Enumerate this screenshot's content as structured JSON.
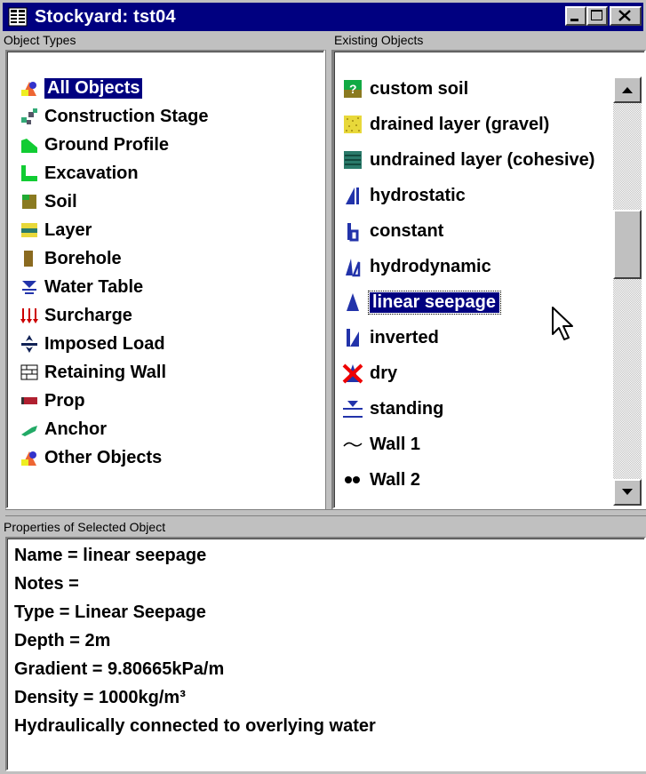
{
  "window": {
    "title": "Stockyard: tst04"
  },
  "object_types": {
    "label": "Object Types",
    "items": [
      {
        "label": "All Objects",
        "icon": "all-objects-icon",
        "selected": true
      },
      {
        "label": "Construction Stage",
        "icon": "construction-stage-icon"
      },
      {
        "label": "Ground Profile",
        "icon": "ground-profile-icon"
      },
      {
        "label": "Excavation",
        "icon": "excavation-icon"
      },
      {
        "label": "Soil",
        "icon": "soil-icon"
      },
      {
        "label": "Layer",
        "icon": "layer-icon"
      },
      {
        "label": "Borehole",
        "icon": "borehole-icon"
      },
      {
        "label": "Water Table",
        "icon": "water-table-icon"
      },
      {
        "label": "Surcharge",
        "icon": "surcharge-icon"
      },
      {
        "label": "Imposed Load",
        "icon": "imposed-load-icon"
      },
      {
        "label": "Retaining Wall",
        "icon": "retaining-wall-icon"
      },
      {
        "label": "Prop",
        "icon": "prop-icon"
      },
      {
        "label": "Anchor",
        "icon": "anchor-icon"
      },
      {
        "label": "Other Objects",
        "icon": "other-objects-icon"
      }
    ]
  },
  "existing_objects": {
    "label": "Existing Objects",
    "items": [
      {
        "label": "custom soil",
        "icon": "custom-soil-icon"
      },
      {
        "label": "drained layer (gravel)",
        "icon": "drained-layer-icon"
      },
      {
        "label": "undrained layer (cohesive)",
        "icon": "undrained-layer-icon"
      },
      {
        "label": "hydrostatic",
        "icon": "hydrostatic-icon"
      },
      {
        "label": "constant",
        "icon": "constant-icon"
      },
      {
        "label": "hydrodynamic",
        "icon": "hydrodynamic-icon"
      },
      {
        "label": "linear seepage",
        "icon": "linear-seepage-icon",
        "selected": true
      },
      {
        "label": "inverted",
        "icon": "inverted-icon"
      },
      {
        "label": "dry",
        "icon": "dry-icon"
      },
      {
        "label": "standing",
        "icon": "standing-icon"
      },
      {
        "label": "Wall 1",
        "icon": "wall-1-icon"
      },
      {
        "label": "Wall 2",
        "icon": "wall-2-icon"
      }
    ]
  },
  "properties": {
    "label": "Properties of Selected Object",
    "lines": [
      "Name = linear seepage",
      "Notes =",
      "Type = Linear Seepage",
      "Depth = 2m",
      "Gradient = 9.80665kPa/m",
      "Density = 1000kg/m³",
      "Hydraulically connected to overlying water"
    ]
  },
  "colors": {
    "titlebar": "#000080",
    "selection": "#000080",
    "chrome": "#c0c0c0"
  }
}
